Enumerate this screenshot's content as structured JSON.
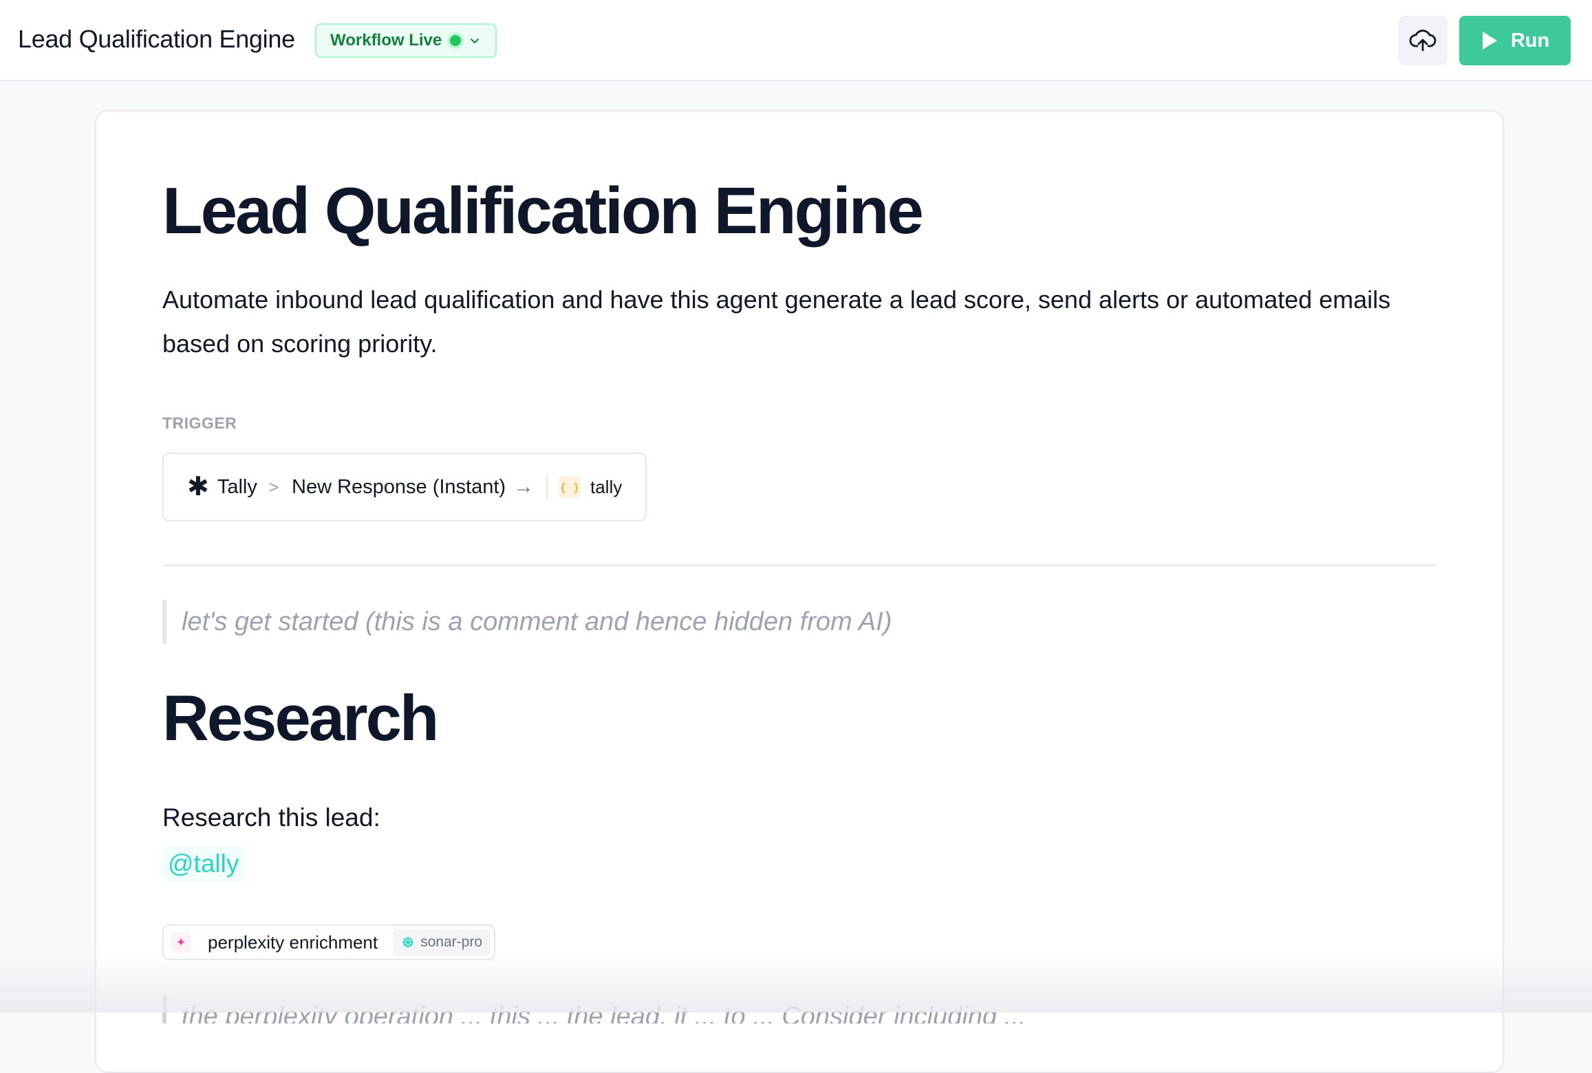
{
  "header": {
    "app_title": "Lead Qualification Engine",
    "status_label": "Workflow Live",
    "status_color": "#22c55e",
    "upload_icon": "cloud-upload-icon",
    "run_label": "Run",
    "accent_color": "#3ec99b"
  },
  "doc": {
    "title": "Lead Qualification Engine",
    "description": "Automate inbound lead qualification and have this agent generate a lead score, send alerts or automated emails based on scoring priority.",
    "trigger_label": "TRIGGER",
    "trigger": {
      "app": "Tally",
      "separator": ">",
      "event": "New Response (Instant)",
      "arrow": "→",
      "variable": "tally"
    },
    "comment": "let's get started (this is a comment and hence hidden from AI)",
    "section_heading": "Research",
    "research_prompt": "Research this lead:",
    "mention": "@tally",
    "tool": {
      "name": "perplexity enrichment",
      "model": "sonar-pro"
    },
    "next_comment": "the perplexity operation ... this ... the lead, it ... to ... Consider including ..."
  }
}
